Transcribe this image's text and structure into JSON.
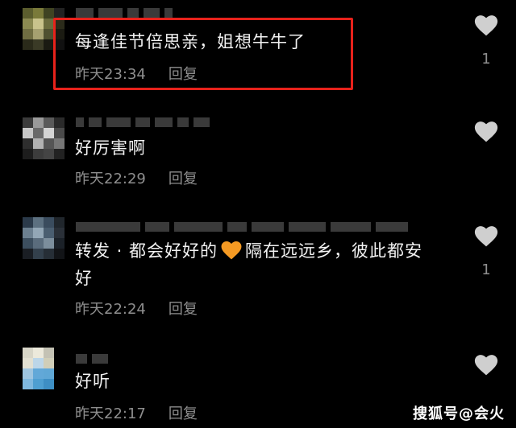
{
  "comments": [
    {
      "text": "每逢佳节倍思亲，姐想牛牛了",
      "time": "昨天23:34",
      "reply": "回复",
      "likes": "1",
      "highlighted": true
    },
    {
      "text": "好厉害啊",
      "time": "昨天22:29",
      "reply": "回复",
      "likes": ""
    },
    {
      "text_before": "转发 · 都会好好的",
      "text_after": "隔在远远乡，彼此都安",
      "text_line2": "好",
      "emoji": "orange-heart",
      "time": "昨天22:24",
      "reply": "回复",
      "likes": "1"
    },
    {
      "text": "好听",
      "time": "昨天22:17",
      "reply": "回复",
      "likes": ""
    }
  ],
  "watermark": "搜狐号@会火",
  "colors": {
    "background": "#000000",
    "highlight_border": "#e8221b",
    "meta_text": "#8e8e8e",
    "heart_icon": "#cfcfcf",
    "emoji_heart": "#f59a23"
  }
}
